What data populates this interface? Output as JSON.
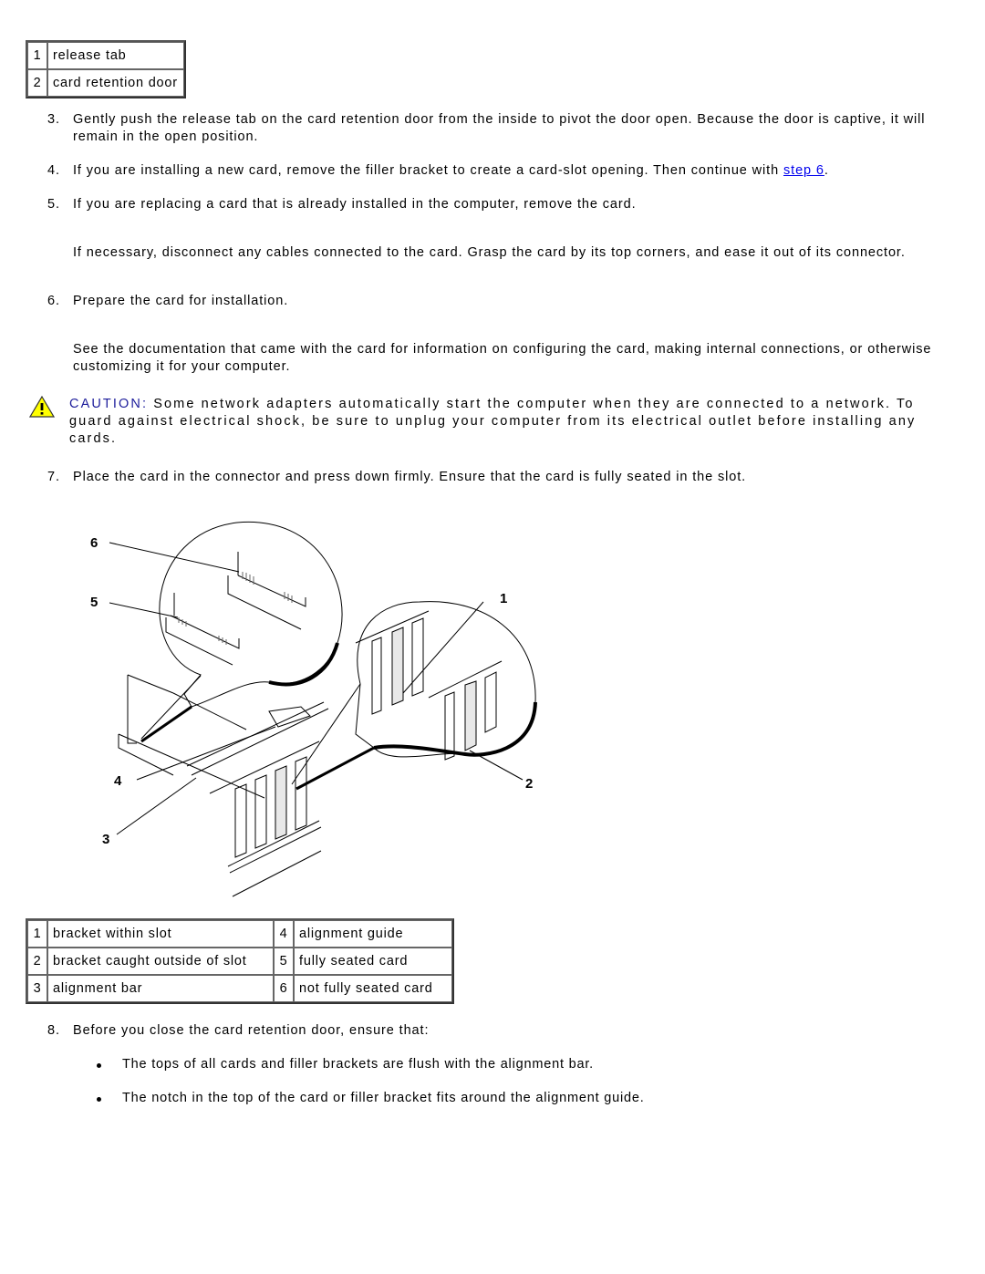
{
  "top_legend": {
    "rows": [
      {
        "num": "1",
        "label": "release tab"
      },
      {
        "num": "2",
        "label": "card retention door"
      }
    ]
  },
  "steps": {
    "s3": {
      "num": "3.",
      "text": "Gently push the release tab on the card retention door from the inside to pivot the door open. Because the door is captive, it will remain in the open position."
    },
    "s4": {
      "num": "4.",
      "text_before": "If you are installing a new card, remove the filler bracket to create a card-slot opening. Then continue with ",
      "link": "step 6",
      "text_after": "."
    },
    "s5": {
      "num": "5.",
      "text": "If you are replacing a card that is already installed in the computer, remove the card."
    },
    "s5_note": "If necessary, disconnect any cables connected to the card. Grasp the card by its top corners, and ease it out of its connector.",
    "s6": {
      "num": "6.",
      "text": "Prepare the card for installation."
    },
    "s6_note": "See the documentation that came with the card for information on configuring the card, making internal connections, or otherwise customizing it for your computer.",
    "s7": {
      "num": "7.",
      "text": "Place the card in the connector and press down firmly. Ensure that the card is fully seated in the slot."
    },
    "s8": {
      "num": "8.",
      "text": "Before you close the card retention door, ensure that:"
    }
  },
  "caution": {
    "icon": "warning-triangle-icon",
    "label": "CAUTION:",
    "text": " Some network adapters automatically start the computer when they are connected to a network. To guard against electrical shock, be sure to unplug your computer from its electrical outlet before installing any cards.",
    "label_color": "#1d1d9b"
  },
  "figure": {
    "callouts": [
      "6",
      "5",
      "4",
      "3",
      "1",
      "2"
    ]
  },
  "figure_legend": {
    "rows": [
      [
        {
          "num": "1",
          "label": "bracket within slot"
        },
        {
          "num": "4",
          "label": "alignment guide"
        }
      ],
      [
        {
          "num": "2",
          "label": "bracket caught outside of slot"
        },
        {
          "num": "5",
          "label": "fully seated card"
        }
      ],
      [
        {
          "num": "3",
          "label": "alignment bar"
        },
        {
          "num": "6",
          "label": "not fully seated card"
        }
      ]
    ]
  },
  "bullets": [
    "The tops of all cards and filler brackets are flush with the alignment bar.",
    "The notch in the top of the card or filler bracket fits around the alignment guide."
  ],
  "colors": {
    "link": "#0000ee",
    "caution_label": "#1d1d9b",
    "warning_fill": "#ffff00"
  }
}
